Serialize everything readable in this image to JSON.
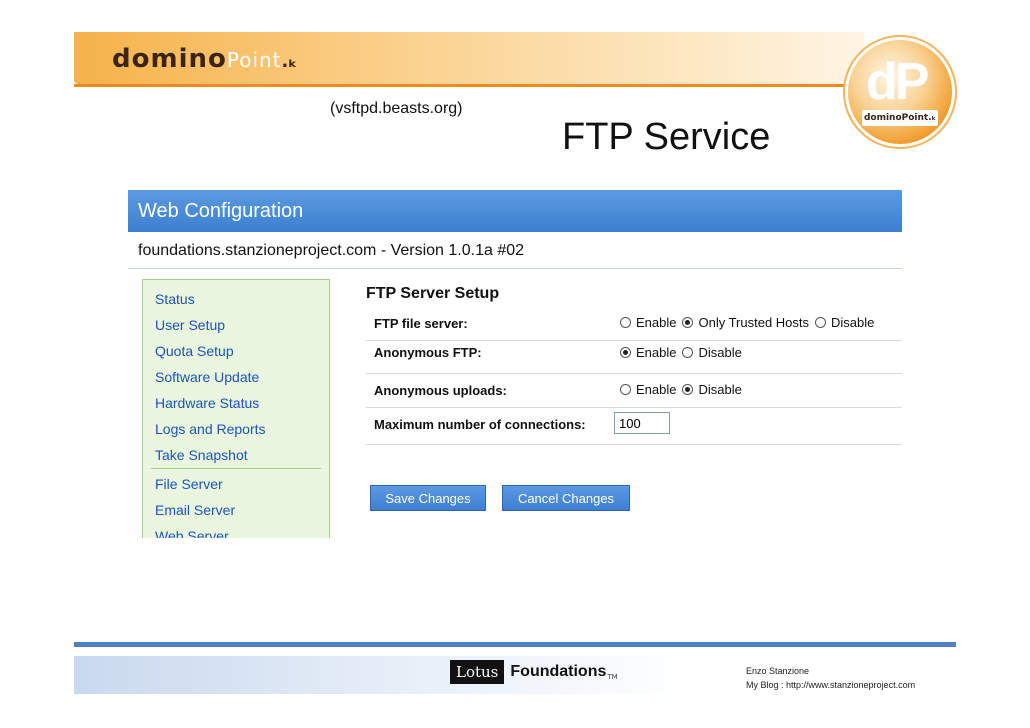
{
  "slide": {
    "brand_bold": "domino",
    "brand_light": "Point",
    "brand_mark": ".ₖ",
    "logo_letters": "dP",
    "logo_sub": "dominoPoint.ₖ",
    "title": "FTP Service",
    "subtitle": "(vsftpd.beasts.org)"
  },
  "app": {
    "header": "Web Configuration",
    "host_line": "foundations.stanzioneproject.com - Version 1.0.1a #02"
  },
  "nav": {
    "items": [
      "Status",
      "User Setup",
      "Quota Setup",
      "Software Update",
      "Hardware Status",
      "Logs and Reports",
      "Take Snapshot"
    ],
    "items2": [
      "File Server",
      "Email Server",
      "Web Server"
    ]
  },
  "form": {
    "title": "FTP Server Setup",
    "ftp_label": "FTP file server:",
    "ftp_options": [
      "Enable",
      "Only Trusted Hosts",
      "Disable"
    ],
    "ftp_selected": "Only Trusted Hosts",
    "anon_label": "Anonymous FTP:",
    "anon_options": [
      "Enable",
      "Disable"
    ],
    "anon_selected": "Enable",
    "uploads_label": "Anonymous uploads:",
    "uploads_options": [
      "Enable",
      "Disable"
    ],
    "uploads_selected": "Disable",
    "max_label": "Maximum number of connections:",
    "max_value": "100",
    "save_label": "Save Changes",
    "cancel_label": "Cancel Changes"
  },
  "footer": {
    "lotus": "Lotus",
    "foundations": "Foundations",
    "tm": "TM",
    "author": "Enzo Stanzione",
    "blog": "My Blog : http://www.stanzioneproject.com"
  },
  "colors": {
    "accent_blue": "#3d7fd0",
    "nav_bg": "#eaf6df",
    "link": "#1a55b8",
    "orange": "#f08a1e"
  }
}
